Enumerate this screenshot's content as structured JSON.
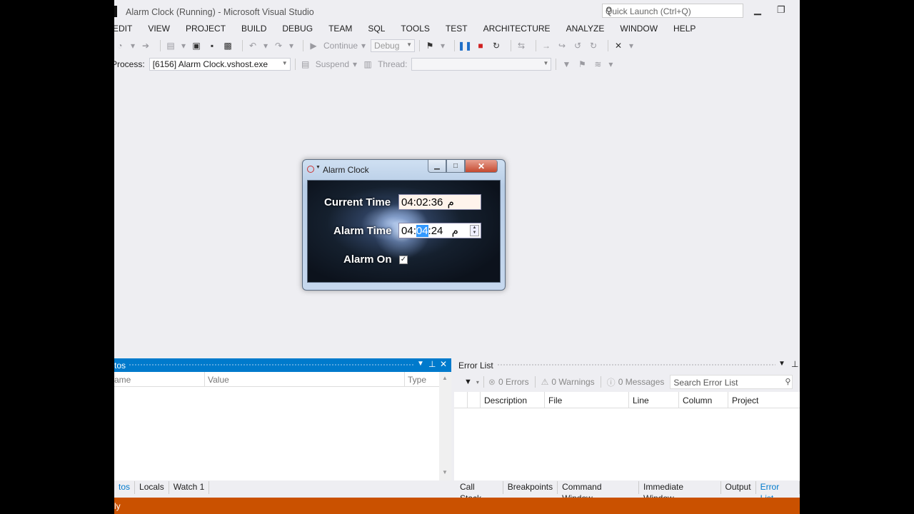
{
  "window": {
    "title": "Alarm Clock (Running) - Microsoft Visual Studio",
    "quick_launch_placeholder": "Quick Launch (Ctrl+Q)"
  },
  "menu": [
    "EDIT",
    "VIEW",
    "PROJECT",
    "BUILD",
    "DEBUG",
    "TEAM",
    "SQL",
    "TOOLS",
    "TEST",
    "ARCHITECTURE",
    "ANALYZE",
    "WINDOW",
    "HELP"
  ],
  "toolbar": {
    "continue_label": "Continue",
    "config_value": "Debug"
  },
  "debug_location": {
    "process_label": "Process:",
    "process_value": "[6156] Alarm Clock.vshost.exe",
    "suspend_label": "Suspend",
    "thread_label": "Thread:"
  },
  "alarm_window": {
    "title": "Alarm Clock",
    "current_time_label": "Current Time",
    "current_time_value": "04:02:36",
    "current_time_suffix": "م",
    "alarm_time_label": "Alarm Time",
    "alarm_time_hours": "04",
    "alarm_time_minutes": "04",
    "alarm_time_seconds": "24",
    "alarm_time_suffix": "م",
    "alarm_on_label": "Alarm On",
    "alarm_on_checked": true
  },
  "autos_pane": {
    "title": "tos",
    "columns": [
      "ame",
      "Value",
      "Type"
    ],
    "tabs": [
      "tos",
      "Locals",
      "Watch 1"
    ]
  },
  "error_list": {
    "title": "Error List",
    "errors": "0 Errors",
    "warnings": "0 Warnings",
    "messages": "0 Messages",
    "search_placeholder": "Search Error List",
    "columns": [
      "Description",
      "File",
      "Line",
      "Column",
      "Project"
    ],
    "tabs": [
      "Call Stack",
      "Breakpoints",
      "Command Window",
      "Immediate Window",
      "Output",
      "Error List"
    ]
  },
  "status_bar": {
    "text": "ly"
  },
  "colors": {
    "accent": "#007acc",
    "status_bar": "#ca5100",
    "stop": "#d02020"
  }
}
